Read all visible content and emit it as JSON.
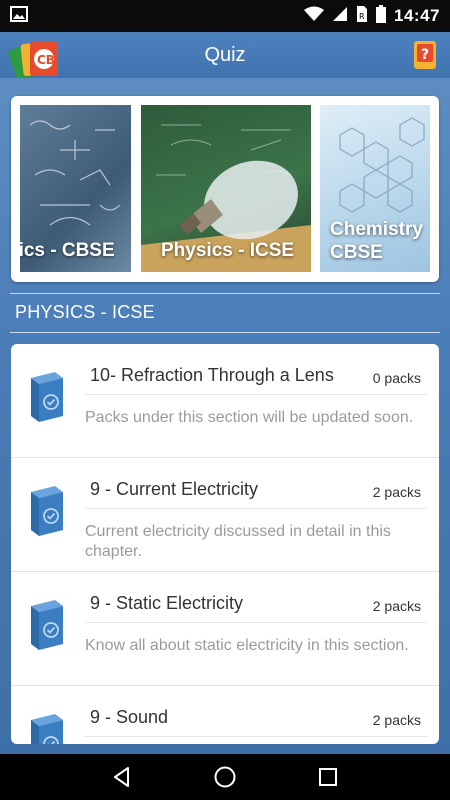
{
  "status_bar": {
    "time": "14:47"
  },
  "app_bar": {
    "title": "Quiz"
  },
  "carousel": {
    "tiles": [
      {
        "label": "sics - CBSE"
      },
      {
        "label": "Physics - ICSE"
      },
      {
        "label": "Chemistry CBSE"
      }
    ]
  },
  "section": {
    "title": "PHYSICS - ICSE"
  },
  "chapters": [
    {
      "title": "10- Refraction Through a Lens",
      "count": "0 packs",
      "description": "Packs under this section will be updated soon."
    },
    {
      "title": "9 - Current Electricity",
      "count": "2 packs",
      "description": "Current electricity discussed in detail in this chapter."
    },
    {
      "title": "9 - Static Electricity",
      "count": "2 packs",
      "description": "Know all about static electricity in this section."
    },
    {
      "title": "9 - Sound",
      "count": "2 packs",
      "description": ""
    }
  ],
  "colors": {
    "app_bar": "#3f74b0",
    "background": "#4a7db7",
    "icon_blue": "#3b7dc1"
  }
}
